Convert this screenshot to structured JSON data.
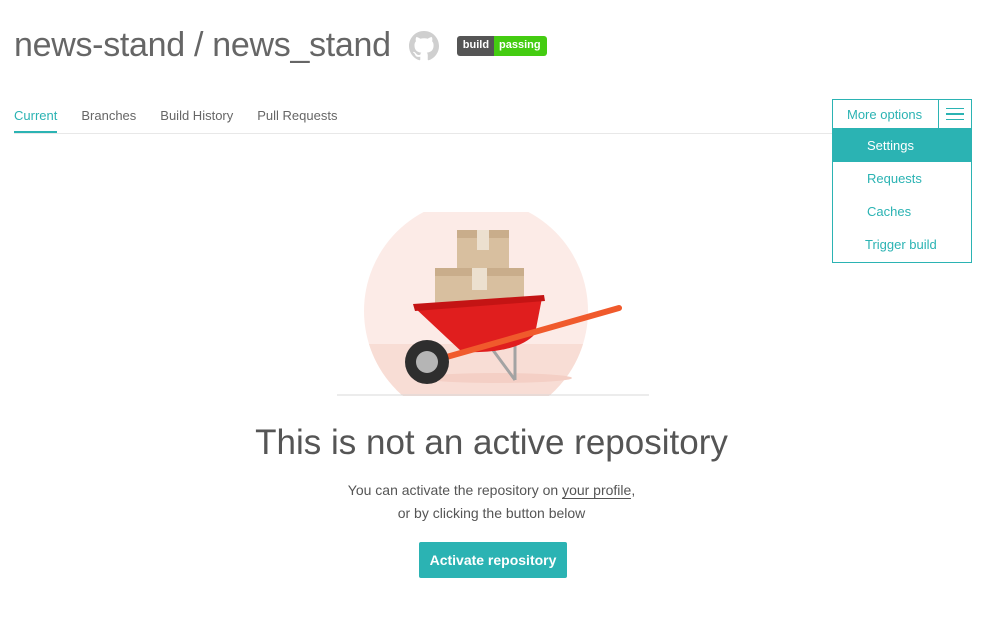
{
  "repo": {
    "title": "news-stand / news_stand",
    "badge_left": "build",
    "badge_right": "passing",
    "icon": "github-icon"
  },
  "tabs": [
    {
      "label": "Current",
      "active": true
    },
    {
      "label": "Branches",
      "active": false
    },
    {
      "label": "Build History",
      "active": false
    },
    {
      "label": "Pull Requests",
      "active": false
    }
  ],
  "options": {
    "label": "More options",
    "menu_icon": "hamburger-icon",
    "items": [
      {
        "label": "Settings",
        "active": true
      },
      {
        "label": "Requests",
        "active": false
      },
      {
        "label": "Caches",
        "active": false
      },
      {
        "label": "Trigger build",
        "active": false
      }
    ]
  },
  "empty_state": {
    "illustration": "wheelbarrow-boxes-illustration",
    "title": "This is not an active repository",
    "line1_prefix": "You can activate the repository on ",
    "line1_link": "your profile",
    "line1_suffix": ",",
    "line2": "or by clicking the button below",
    "button_label": "Activate repository"
  },
  "colors": {
    "accent": "#2bb3b3",
    "badge_pass": "#44cc11",
    "badge_dark": "#555555",
    "wheelbarrow": "#e01e1e",
    "handle": "#f05a2c"
  }
}
